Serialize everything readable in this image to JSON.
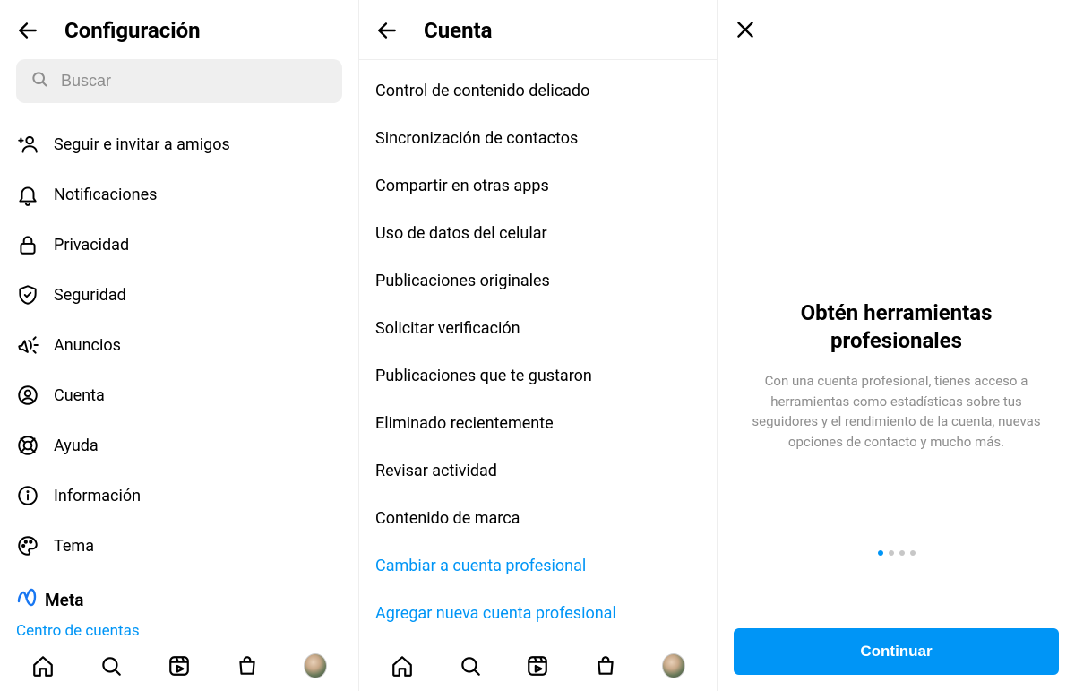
{
  "panel1": {
    "title": "Configuración",
    "search_placeholder": "Buscar",
    "items": [
      {
        "icon": "add-friend-icon",
        "label": "Seguir e invitar a amigos"
      },
      {
        "icon": "bell-icon",
        "label": "Notificaciones"
      },
      {
        "icon": "lock-icon",
        "label": "Privacidad"
      },
      {
        "icon": "shield-icon",
        "label": "Seguridad"
      },
      {
        "icon": "megaphone-icon",
        "label": "Anuncios"
      },
      {
        "icon": "user-circle-icon",
        "label": "Cuenta"
      },
      {
        "icon": "lifebuoy-icon",
        "label": "Ayuda"
      },
      {
        "icon": "info-icon",
        "label": "Información"
      },
      {
        "icon": "palette-icon",
        "label": "Tema"
      }
    ],
    "meta_label": "Meta",
    "accounts_center": "Centro de cuentas"
  },
  "panel2": {
    "title": "Cuenta",
    "items": [
      "Control de contenido delicado",
      "Sincronización de contactos",
      "Compartir en otras apps",
      "Uso de datos del celular",
      "Publicaciones originales",
      "Solicitar verificación",
      "Publicaciones que te gustaron",
      "Eliminado recientemente",
      "Revisar actividad",
      "Contenido de marca"
    ],
    "link1": "Cambiar a cuenta profesional",
    "link2": "Agregar nueva cuenta profesional"
  },
  "panel3": {
    "title": "Obtén herramientas profesionales",
    "description": "Con una cuenta profesional, tienes acceso a herramientas como estadísticas sobre tus seguidores y el rendimiento de la cuenta, nuevas opciones de contacto y mucho más.",
    "dots_total": 4,
    "dots_active_index": 0,
    "continue": "Continuar"
  }
}
